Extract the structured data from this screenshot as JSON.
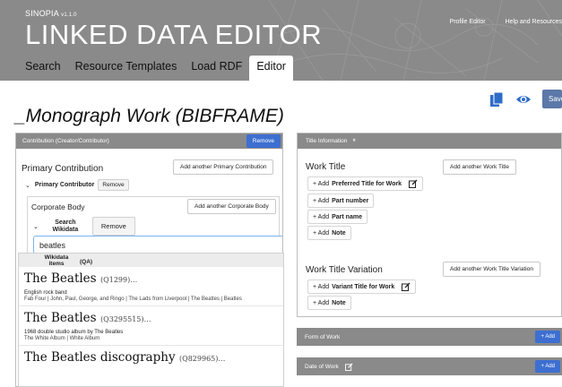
{
  "header": {
    "brand": "SINOPIA",
    "version": "v1.1.0",
    "title": "LINKED DATA EDITOR",
    "links": [
      "Profile Editor",
      "Help and Resources"
    ],
    "tabs": [
      "Search",
      "Resource Templates",
      "Load RDF",
      "Editor"
    ],
    "active_tab": "Editor"
  },
  "page": {
    "title": "_Monograph Work (BIBFRAME)",
    "save_label": "Save"
  },
  "left_panel": {
    "header": "Contribution (Creator/Contributor)",
    "remove_label": "Remove",
    "primary_contribution_label": "Primary Contribution",
    "add_primary_label": "Add another Primary Contribution",
    "primary_contributor_label": "Primary Contributor",
    "primary_contributor_remove": "Remove",
    "corporate_body_label": "Corporate Body",
    "add_corporate_label": "Add another Corporate Body",
    "search_wikidata_label": "Search Wikidata",
    "search_remove_label": "Remove",
    "search_value": "beatles"
  },
  "dropdown": {
    "header_label": "Wikidata items",
    "header_count": "(QA)",
    "results": [
      {
        "title": "The Beatles",
        "qid": "(Q1299)…",
        "desc": "English rock band",
        "aliases": "Fab Four | John, Paul, George, and Ringo | The Lads from Liverpool | The Beatles | Beatles"
      },
      {
        "title": "The Beatles",
        "qid": "(Q3295515)…",
        "desc": "1968 double studio album by The Beatles",
        "aliases": "The White Album | White Album"
      },
      {
        "title": "The Beatles discography",
        "qid": "(Q829965)…",
        "desc": "",
        "aliases": ""
      }
    ]
  },
  "right_panel": {
    "header": "Title Information",
    "required_marker": "*",
    "work_title_label": "Work Title",
    "add_work_title_label": "Add another Work Title",
    "add_buttons_1": [
      {
        "prefix": "+ Add",
        "bold": "Preferred Title for Work"
      },
      {
        "prefix": "+ Add",
        "bold": "Part number"
      },
      {
        "prefix": "+ Add",
        "bold": "Part name"
      },
      {
        "prefix": "+ Add",
        "bold": "Note"
      }
    ],
    "work_title_variation_label": "Work Title Variation",
    "add_variation_label": "Add another Work Title Variation",
    "add_buttons_2": [
      {
        "prefix": "+ Add",
        "bold": "Variant Title for Work"
      },
      {
        "prefix": "+ Add",
        "bold": "Note"
      }
    ]
  },
  "sections": [
    {
      "label": "Form of Work",
      "add": "+ Add"
    },
    {
      "label": "Date of Work",
      "add": "+ Add"
    }
  ],
  "colors": {
    "header_gray": "#8a8a8a",
    "primary_blue": "#3d6fd1",
    "save_blue": "#5b78a8",
    "icon_blue": "#2e6cc9"
  }
}
